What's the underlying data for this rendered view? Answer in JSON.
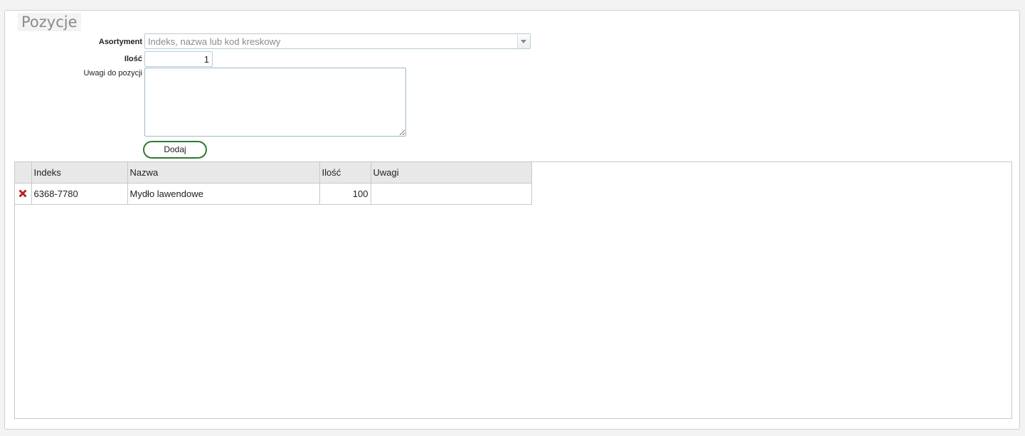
{
  "section": {
    "title": "Pozycje"
  },
  "form": {
    "assortment_label": "Asortyment",
    "assortment_placeholder": "Indeks, nazwa lub kod kreskowy",
    "quantity_label": "Ilość",
    "quantity_value": "1",
    "notes_label": "Uwagi do pozycji",
    "notes_value": "",
    "add_button": "Dodaj"
  },
  "grid": {
    "columns": [
      "Indeks",
      "Nazwa",
      "Ilość",
      "Uwagi"
    ],
    "rows": [
      {
        "indeks": "6368-7780",
        "nazwa": "Mydło lawendowe",
        "ilosc": "100",
        "uwagi": "",
        "action_icon": "delete-icon"
      }
    ]
  },
  "colors": {
    "add_button_border": "#2f7a2f",
    "delete_icon": "#d11f1f",
    "header_bg": "#e8e8e8"
  }
}
